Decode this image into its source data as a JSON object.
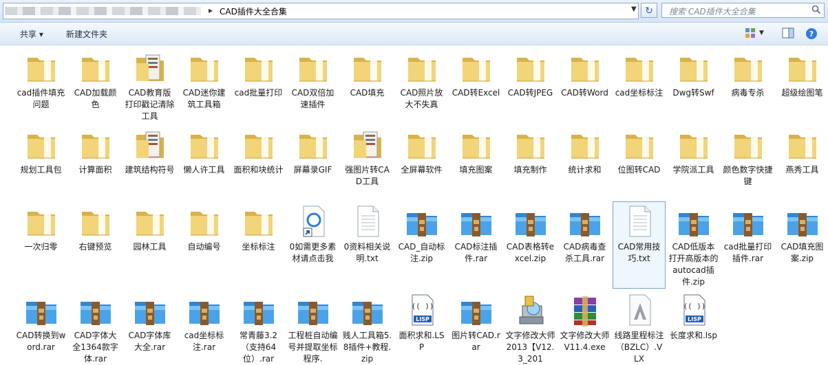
{
  "address": {
    "path_current": "CAD插件大全合集",
    "separator": "▸"
  },
  "search": {
    "placeholder": "搜索 CAD插件大全合集"
  },
  "toolbar": {
    "share_label": "共享 ▾",
    "newfolder_label": "新建文件夹"
  },
  "items": [
    {
      "label": "cad插件填充问题",
      "type": "folder"
    },
    {
      "label": "CAD加载颜色",
      "type": "folder"
    },
    {
      "label": "CAD教育版打印戳记清除工具",
      "type": "folder-doc"
    },
    {
      "label": "CAD迷你建筑工具箱",
      "type": "folder"
    },
    {
      "label": "cad批量打印",
      "type": "folder"
    },
    {
      "label": "CAD双倍加速插件",
      "type": "folder"
    },
    {
      "label": "CAD填充",
      "type": "folder"
    },
    {
      "label": "CAD照片放大不失真",
      "type": "folder"
    },
    {
      "label": "CAD转Excel",
      "type": "folder"
    },
    {
      "label": "CAD转JPEG",
      "type": "folder"
    },
    {
      "label": "CAD转Word",
      "type": "folder"
    },
    {
      "label": "cad坐标标注",
      "type": "folder"
    },
    {
      "label": "Dwg转Swf",
      "type": "folder"
    },
    {
      "label": "病毒专杀",
      "type": "folder"
    },
    {
      "label": "超级绘图笔",
      "type": "folder"
    },
    {
      "label": "规划工具包",
      "type": "folder"
    },
    {
      "label": "计算面积",
      "type": "folder"
    },
    {
      "label": "建筑结构符号",
      "type": "folder-doc"
    },
    {
      "label": "懒人许工具",
      "type": "folder"
    },
    {
      "label": "面积和块统计",
      "type": "folder"
    },
    {
      "label": "屏幕录GIF",
      "type": "folder"
    },
    {
      "label": "强图片转CAD工具",
      "type": "folder-doc"
    },
    {
      "label": "全屏幕软件",
      "type": "folder"
    },
    {
      "label": "填充图案",
      "type": "folder"
    },
    {
      "label": "填充制作",
      "type": "folder"
    },
    {
      "label": "统计求和",
      "type": "folder"
    },
    {
      "label": "位图转CAD",
      "type": "folder"
    },
    {
      "label": "学院派工具",
      "type": "folder"
    },
    {
      "label": "颜色数字快捷键",
      "type": "folder"
    },
    {
      "label": "燕秀工具",
      "type": "folder"
    },
    {
      "label": "一次归零",
      "type": "folder"
    },
    {
      "label": "右键预览",
      "type": "folder"
    },
    {
      "label": "园林工具",
      "type": "folder"
    },
    {
      "label": "自动编号",
      "type": "folder"
    },
    {
      "label": "坐标标注",
      "type": "folder"
    },
    {
      "label": "0如需更多素材请点击我",
      "type": "shortcut"
    },
    {
      "label": "0资料相关说明.txt",
      "type": "txt"
    },
    {
      "label": "CAD_自动标注.zip",
      "type": "archive"
    },
    {
      "label": "CAD标注插件.rar",
      "type": "archive"
    },
    {
      "label": "CAD表格转excel.zip",
      "type": "archive"
    },
    {
      "label": "CAD病毒查杀工具.rar",
      "type": "archive"
    },
    {
      "label": "CAD常用技巧.txt",
      "type": "txt",
      "selected": true
    },
    {
      "label": "CAD低版本打开高版本的autocad插件.zip",
      "type": "archive"
    },
    {
      "label": "cad批量打印插件.rar",
      "type": "archive"
    },
    {
      "label": "CAD填充图案.zip",
      "type": "archive"
    },
    {
      "label": "CAD转换到word.rar",
      "type": "archive"
    },
    {
      "label": "CAD字体大全1364款字体.rar",
      "type": "archive"
    },
    {
      "label": "CAD字体库大全.rar",
      "type": "archive"
    },
    {
      "label": "cad坐标标注.rar",
      "type": "archive"
    },
    {
      "label": "常青藤3.2（支持64位）.rar",
      "type": "archive"
    },
    {
      "label": "工程桩自动编号并提取坐标程序.",
      "type": "archive"
    },
    {
      "label": "贱人工具箱5.8插件+教程.zip",
      "type": "archive"
    },
    {
      "label": "面积求和.LSP",
      "type": "lisp"
    },
    {
      "label": "图片转CAD.rar",
      "type": "archive"
    },
    {
      "label": "文字修改大师2013【V12.3_201",
      "type": "installer"
    },
    {
      "label": "文字修改大师V11.4.exe",
      "type": "winrar"
    },
    {
      "label": "线路里程标注（BZLC）.VLX",
      "type": "vlx"
    },
    {
      "label": "长度求和.lsp",
      "type": "lisp"
    }
  ],
  "colors": {
    "folder": "#f2d479",
    "folder_dark": "#d9b24a",
    "archive_top": "#4aa3e8",
    "archive_strap": "#8a5a2b",
    "selection": "#7da2ce"
  }
}
